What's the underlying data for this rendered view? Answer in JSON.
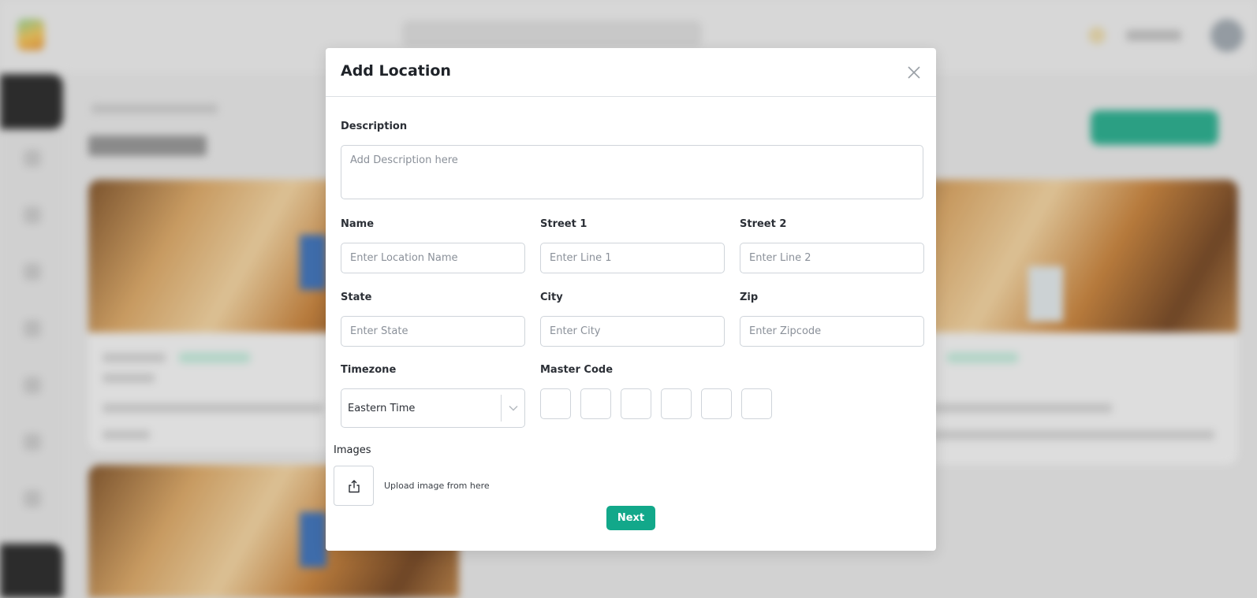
{
  "modal": {
    "title": "Add Location",
    "description": {
      "label": "Description",
      "placeholder": "Add Description here"
    },
    "name": {
      "label": "Name",
      "placeholder": "Enter Location Name"
    },
    "street1": {
      "label": "Street 1",
      "placeholder": "Enter Line 1"
    },
    "street2": {
      "label": "Street 2",
      "placeholder": "Enter Line 2"
    },
    "state": {
      "label": "State",
      "placeholder": "Enter State"
    },
    "city": {
      "label": "City",
      "placeholder": "Enter City"
    },
    "zip": {
      "label": "Zip",
      "placeholder": "Enter Zipcode"
    },
    "timezone": {
      "label": "Timezone",
      "value": "Eastern Time"
    },
    "master_code": {
      "label": "Master Code",
      "digits": [
        "",
        "",
        "",
        "",
        "",
        ""
      ]
    },
    "images": {
      "label": "Images",
      "upload_text": "Upload image from here"
    },
    "next_label": "Next"
  },
  "icons": {
    "close": "close-icon",
    "dropdown": "chevron-down-icon",
    "upload": "upload-icon"
  },
  "colors": {
    "primary": "#12a88a",
    "backdrop": "#e6e6e6",
    "border": "#cfd4da"
  }
}
